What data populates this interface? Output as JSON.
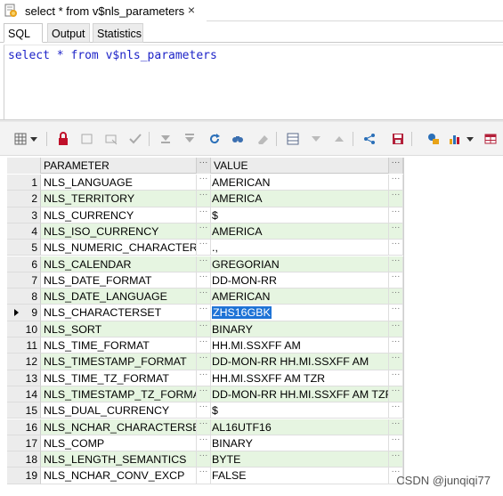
{
  "document_tab": {
    "title": "select * from v$nls_parameters",
    "close": "×"
  },
  "sub_tabs": [
    "SQL",
    "Output",
    "Statistics"
  ],
  "editor": {
    "keyword_select": "select",
    "star": "*",
    "keyword_from": "from",
    "table": "v$nls_parameters"
  },
  "toolbar_icons": [
    "grid-options-icon",
    "dropdown-arrow-icon",
    "lock-icon",
    "insert-record-icon",
    "delete-record-icon",
    "post-edit-icon",
    "first-record-icon",
    "last-record-icon",
    "refresh-icon",
    "find-icon",
    "clear-icon",
    "query-by-example-icon",
    "previous-icon",
    "next-icon",
    "export-icon",
    "save-icon",
    "link-icon",
    "chart-icon",
    "chart-dropdown-icon",
    "table-icon"
  ],
  "grid": {
    "columns": [
      "PARAMETER",
      "VALUE"
    ],
    "dots": "···",
    "selected_row": 9,
    "rows": [
      {
        "num": "1",
        "parameter": "NLS_LANGUAGE",
        "value": "AMERICAN"
      },
      {
        "num": "2",
        "parameter": "NLS_TERRITORY",
        "value": "AMERICA"
      },
      {
        "num": "3",
        "parameter": "NLS_CURRENCY",
        "value": "$"
      },
      {
        "num": "4",
        "parameter": "NLS_ISO_CURRENCY",
        "value": "AMERICA"
      },
      {
        "num": "5",
        "parameter": "NLS_NUMERIC_CHARACTERS",
        "value": ".,"
      },
      {
        "num": "6",
        "parameter": "NLS_CALENDAR",
        "value": "GREGORIAN"
      },
      {
        "num": "7",
        "parameter": "NLS_DATE_FORMAT",
        "value": "DD-MON-RR"
      },
      {
        "num": "8",
        "parameter": "NLS_DATE_LANGUAGE",
        "value": "AMERICAN"
      },
      {
        "num": "9",
        "parameter": "NLS_CHARACTERSET",
        "value": "ZHS16GBK"
      },
      {
        "num": "10",
        "parameter": "NLS_SORT",
        "value": "BINARY"
      },
      {
        "num": "11",
        "parameter": "NLS_TIME_FORMAT",
        "value": "HH.MI.SSXFF AM"
      },
      {
        "num": "12",
        "parameter": "NLS_TIMESTAMP_FORMAT",
        "value": "DD-MON-RR HH.MI.SSXFF AM"
      },
      {
        "num": "13",
        "parameter": "NLS_TIME_TZ_FORMAT",
        "value": "HH.MI.SSXFF AM TZR"
      },
      {
        "num": "14",
        "parameter": "NLS_TIMESTAMP_TZ_FORMAT",
        "value": "DD-MON-RR HH.MI.SSXFF AM TZR"
      },
      {
        "num": "15",
        "parameter": "NLS_DUAL_CURRENCY",
        "value": "$"
      },
      {
        "num": "16",
        "parameter": "NLS_NCHAR_CHARACTERSET",
        "value": "AL16UTF16"
      },
      {
        "num": "17",
        "parameter": "NLS_COMP",
        "value": "BINARY"
      },
      {
        "num": "18",
        "parameter": "NLS_LENGTH_SEMANTICS",
        "value": "BYTE"
      },
      {
        "num": "19",
        "parameter": "NLS_NCHAR_CONV_EXCP",
        "value": "FALSE"
      }
    ]
  },
  "watermark": "CSDN @junqiqi77",
  "colors": {
    "keyword": "#1e24c8",
    "alt_row": "#e6f5e1",
    "selection": "#1e73d6"
  }
}
